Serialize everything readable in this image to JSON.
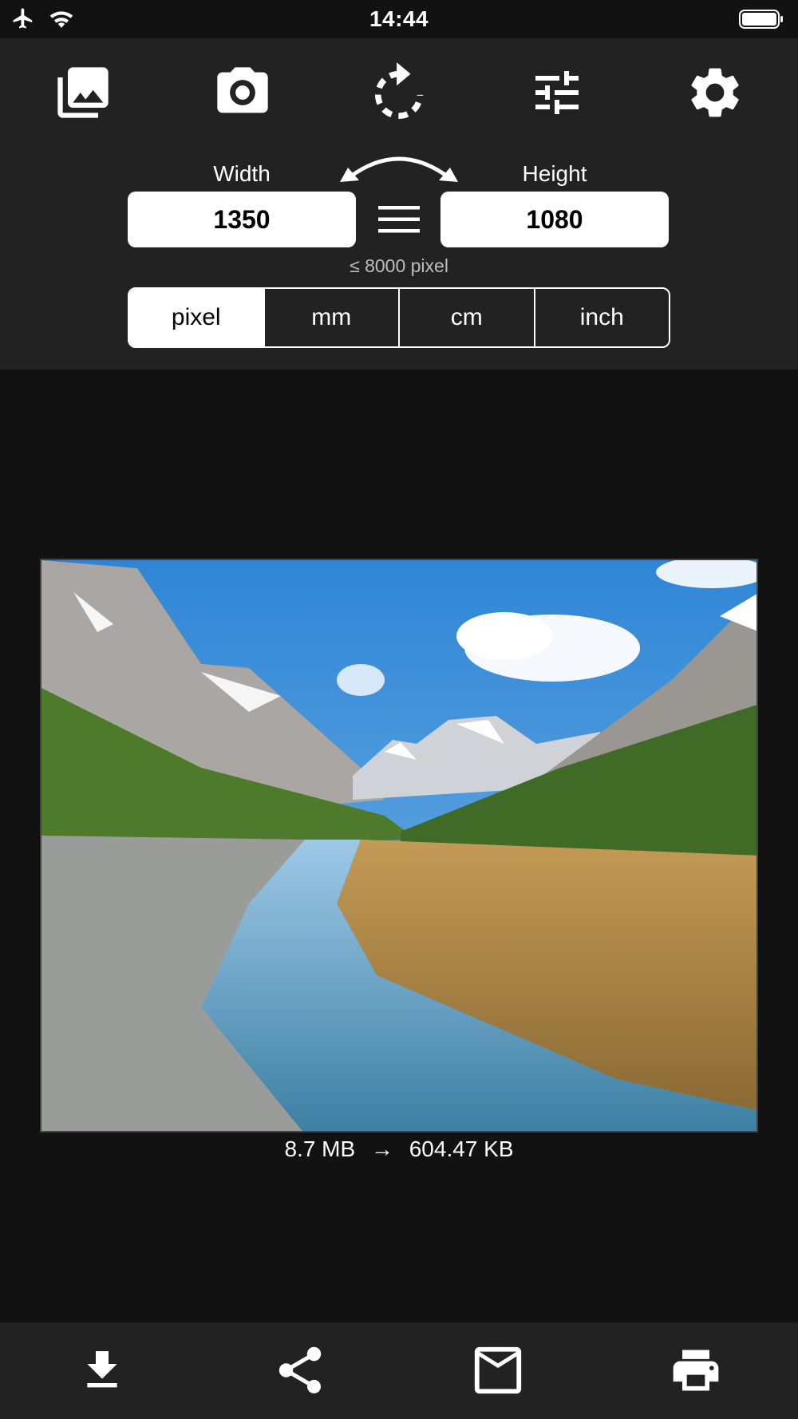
{
  "status_bar": {
    "time": "14:44",
    "icons": [
      "airplane-icon",
      "wifi-icon",
      "battery-icon"
    ]
  },
  "toolbar": {
    "icons": [
      "gallery-icon",
      "camera-icon",
      "rotate-icon",
      "adjust-sliders-icon",
      "settings-gear-icon"
    ]
  },
  "dimensions": {
    "width_label": "Width",
    "height_label": "Height",
    "width_value": "1350",
    "height_value": "1080",
    "limit_note": "≤ 8000 pixel",
    "swap_icon": "swap-arrows-icon",
    "lock_icon": "menu-lines-icon"
  },
  "units": {
    "options": [
      "pixel",
      "mm",
      "cm",
      "inch"
    ],
    "selected": "pixel"
  },
  "preview": {
    "original_size": "8.7 MB",
    "arrow": "→",
    "new_size": "604.47 KB"
  },
  "bottom_bar": {
    "icons": [
      "download-icon",
      "share-icon",
      "mail-icon",
      "print-icon"
    ]
  },
  "colors": {
    "background": "#121212",
    "panel": "#222222",
    "accent": "#ffffff"
  }
}
